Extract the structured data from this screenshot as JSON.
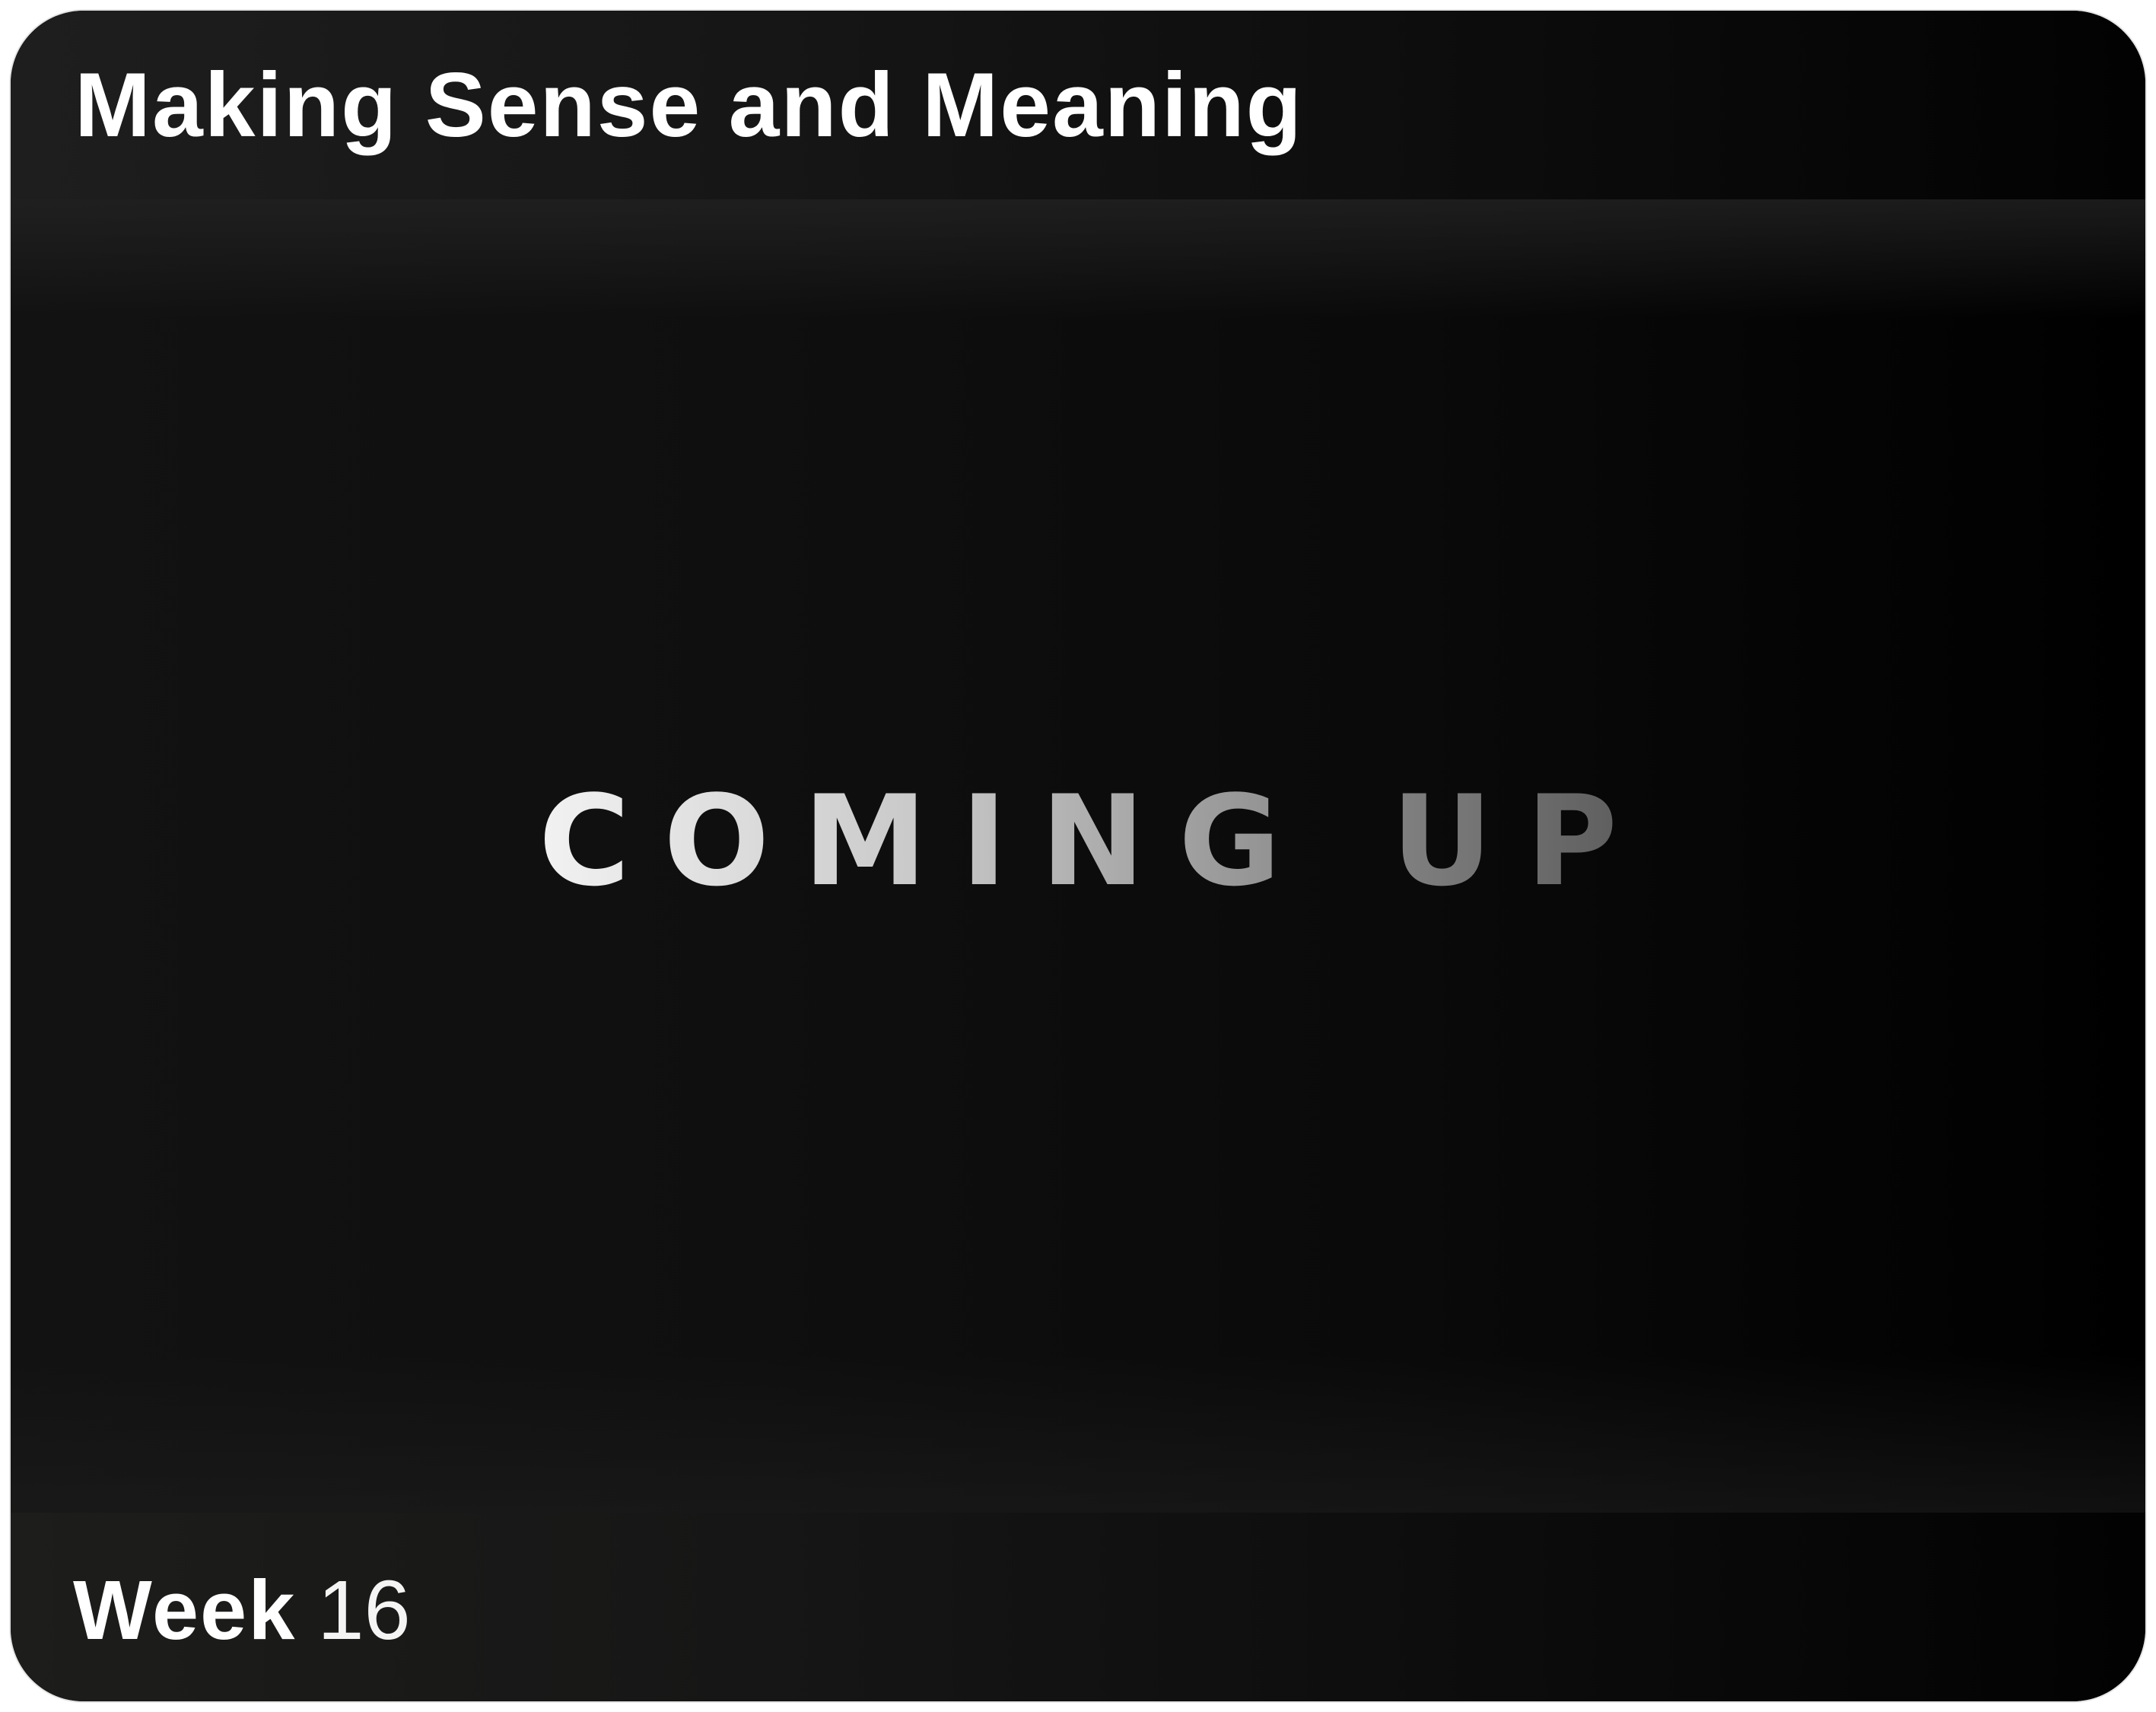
{
  "header": {
    "title": "Making Sense and Meaning"
  },
  "main": {
    "status_text": "COMING UP"
  },
  "footer": {
    "week_label": "Week",
    "week_number": "16"
  },
  "colors": {
    "background": "#0b0b0b",
    "text": "#ffffff",
    "accent_start": "#f2f2f2",
    "accent_end": "#5a5a5a"
  }
}
